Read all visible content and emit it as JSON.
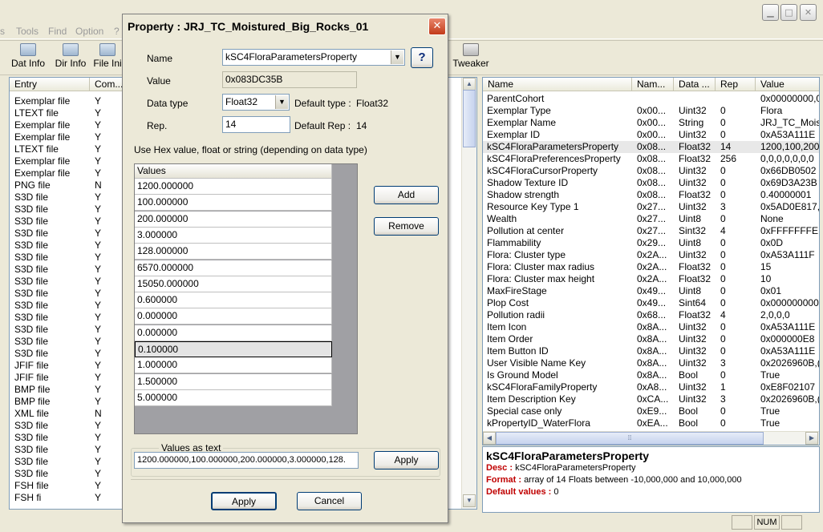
{
  "main_menu": [
    "s",
    "Tools",
    "Find",
    "Option",
    "?"
  ],
  "toolbar": {
    "items": [
      "Dat Info",
      "Dir Info",
      "File Ini",
      "Tweaker"
    ]
  },
  "left_table": {
    "columns": [
      "Entry",
      "Com..."
    ],
    "rows": [
      [
        "Exemplar file",
        "Y"
      ],
      [
        "LTEXT file",
        "Y"
      ],
      [
        "Exemplar file",
        "Y"
      ],
      [
        "Exemplar file",
        "Y"
      ],
      [
        "LTEXT file",
        "Y"
      ],
      [
        "Exemplar file",
        "Y"
      ],
      [
        "Exemplar file",
        "Y"
      ],
      [
        "PNG file",
        "N"
      ],
      [
        "S3D file",
        "Y"
      ],
      [
        "S3D file",
        "Y"
      ],
      [
        "S3D file",
        "Y"
      ],
      [
        "S3D file",
        "Y"
      ],
      [
        "S3D file",
        "Y"
      ],
      [
        "S3D file",
        "Y"
      ],
      [
        "S3D file",
        "Y"
      ],
      [
        "S3D file",
        "Y"
      ],
      [
        "S3D file",
        "Y"
      ],
      [
        "S3D file",
        "Y"
      ],
      [
        "S3D file",
        "Y"
      ],
      [
        "S3D file",
        "Y"
      ],
      [
        "S3D file",
        "Y"
      ],
      [
        "S3D file",
        "Y"
      ],
      [
        "JFIF file",
        "Y"
      ],
      [
        "JFIF file",
        "Y"
      ],
      [
        "BMP file",
        "Y"
      ],
      [
        "BMP file",
        "Y"
      ],
      [
        "XML file",
        "N"
      ],
      [
        "S3D file",
        "Y"
      ],
      [
        "S3D file",
        "Y"
      ],
      [
        "S3D file",
        "Y"
      ],
      [
        "S3D file",
        "Y"
      ],
      [
        "S3D file",
        "Y"
      ],
      [
        "FSH file",
        "Y"
      ],
      [
        "FSH fi",
        "Y"
      ]
    ]
  },
  "right_table": {
    "columns": [
      "Name",
      "Nam...",
      "Data ...",
      "Rep",
      "Value"
    ],
    "rows": [
      [
        "ParentCohort",
        "",
        "",
        "",
        "0x00000000,0"
      ],
      [
        "Exemplar Type",
        "0x00...",
        "Uint32",
        "0",
        "Flora"
      ],
      [
        "Exemplar Name",
        "0x00...",
        "String",
        "0",
        "JRJ_TC_Moist"
      ],
      [
        "Exemplar ID",
        "0x00...",
        "Uint32",
        "0",
        "0xA53A111E"
      ],
      [
        "kSC4FloraParametersProperty",
        "0x08...",
        "Float32",
        "14",
        "1200,100,200"
      ],
      [
        "kSC4FloraPreferencesProperty",
        "0x08...",
        "Float32",
        "256",
        "0,0,0,0,0,0,0"
      ],
      [
        "kSC4FloraCursorProperty",
        "0x08...",
        "Uint32",
        "0",
        "0x66DB0502"
      ],
      [
        "Shadow Texture ID",
        "0x08...",
        "Uint32",
        "0",
        "0x69D3A23B"
      ],
      [
        "Shadow strength",
        "0x08...",
        "Float32",
        "0",
        "0.40000001"
      ],
      [
        "Resource Key Type 1",
        "0x27...",
        "Uint32",
        "3",
        "0x5AD0E817,"
      ],
      [
        "Wealth",
        "0x27...",
        "Uint8",
        "0",
        "None"
      ],
      [
        "Pollution at center",
        "0x27...",
        "Sint32",
        "4",
        "0xFFFFFFFE,("
      ],
      [
        "Flammability",
        "0x29...",
        "Uint8",
        "0",
        "0x0D"
      ],
      [
        "Flora: Cluster type",
        "0x2A...",
        "Uint32",
        "0",
        "0xA53A111F"
      ],
      [
        "Flora: Cluster max radius",
        "0x2A...",
        "Float32",
        "0",
        "15"
      ],
      [
        "Flora: Cluster max height",
        "0x2A...",
        "Float32",
        "0",
        "10"
      ],
      [
        "MaxFireStage",
        "0x49...",
        "Uint8",
        "0",
        "0x01"
      ],
      [
        "Plop Cost",
        "0x49...",
        "Sint64",
        "0",
        "0x000000000"
      ],
      [
        "Pollution radii",
        "0x68...",
        "Float32",
        "4",
        "2,0,0,0"
      ],
      [
        "Item Icon",
        "0x8A...",
        "Uint32",
        "0",
        "0xA53A111E"
      ],
      [
        "Item Order",
        "0x8A...",
        "Uint32",
        "0",
        "0x000000E8"
      ],
      [
        "Item Button ID",
        "0x8A...",
        "Uint32",
        "0",
        "0xA53A111E"
      ],
      [
        "User Visible Name Key",
        "0x8A...",
        "Uint32",
        "3",
        "0x2026960B,("
      ],
      [
        "Is Ground Model",
        "0x8A...",
        "Bool",
        "0",
        "True"
      ],
      [
        "kSC4FloraFamilyProperty",
        "0xA8...",
        "Uint32",
        "1",
        "0xE8F02107"
      ],
      [
        "Item Description Key",
        "0xCA...",
        "Uint32",
        "3",
        "0x2026960B,("
      ],
      [
        "Special case only",
        "0xE9...",
        "Bool",
        "0",
        "True"
      ],
      [
        "kPropertyID_WaterFlora",
        "0xEA...",
        "Bool",
        "0",
        "True"
      ]
    ],
    "selected_index": 4
  },
  "info": {
    "title": "kSC4FloraParametersProperty",
    "desc_label": "Desc :",
    "desc": "kSC4FloraParametersProperty",
    "format_label": "Format :",
    "format": "array of 14 Floats between -10,000,000 and 10,000,000",
    "default_label": "Default values :",
    "default": "0"
  },
  "status": {
    "num": "NUM"
  },
  "dialog": {
    "title": "Property : JRJ_TC_Moistured_Big_Rocks_01",
    "close": "✕",
    "name_label": "Name",
    "name_value": "kSC4FloraParametersProperty",
    "help": "?",
    "value_label": "Value",
    "value_value": "0x083DC35B",
    "datatype_label": "Data type",
    "datatype_value": "Float32",
    "default_type_label": "Default type :",
    "default_type_value": "Float32",
    "rep_label": "Rep.",
    "rep_value": "14",
    "default_rep_label": "Default Rep :",
    "default_rep_value": "14",
    "hint": "Use Hex value, float or string (depending on data type)",
    "values_header": "Values",
    "values": [
      "1200.000000",
      "100.000000",
      "200.000000",
      "3.000000",
      "128.000000",
      "6570.000000",
      "15050.000000",
      "0.600000",
      "0.000000",
      "0.000000",
      "0.100000",
      "1.000000",
      "1.500000",
      "5.000000"
    ],
    "selected_value_index": 10,
    "add": "Add",
    "remove": "Remove",
    "values_as_text_label": "Values as text",
    "values_as_text": "1200.000000,100.000000,200.000000,3.000000,128.",
    "apply_text": "Apply",
    "apply": "Apply",
    "cancel": "Cancel"
  }
}
